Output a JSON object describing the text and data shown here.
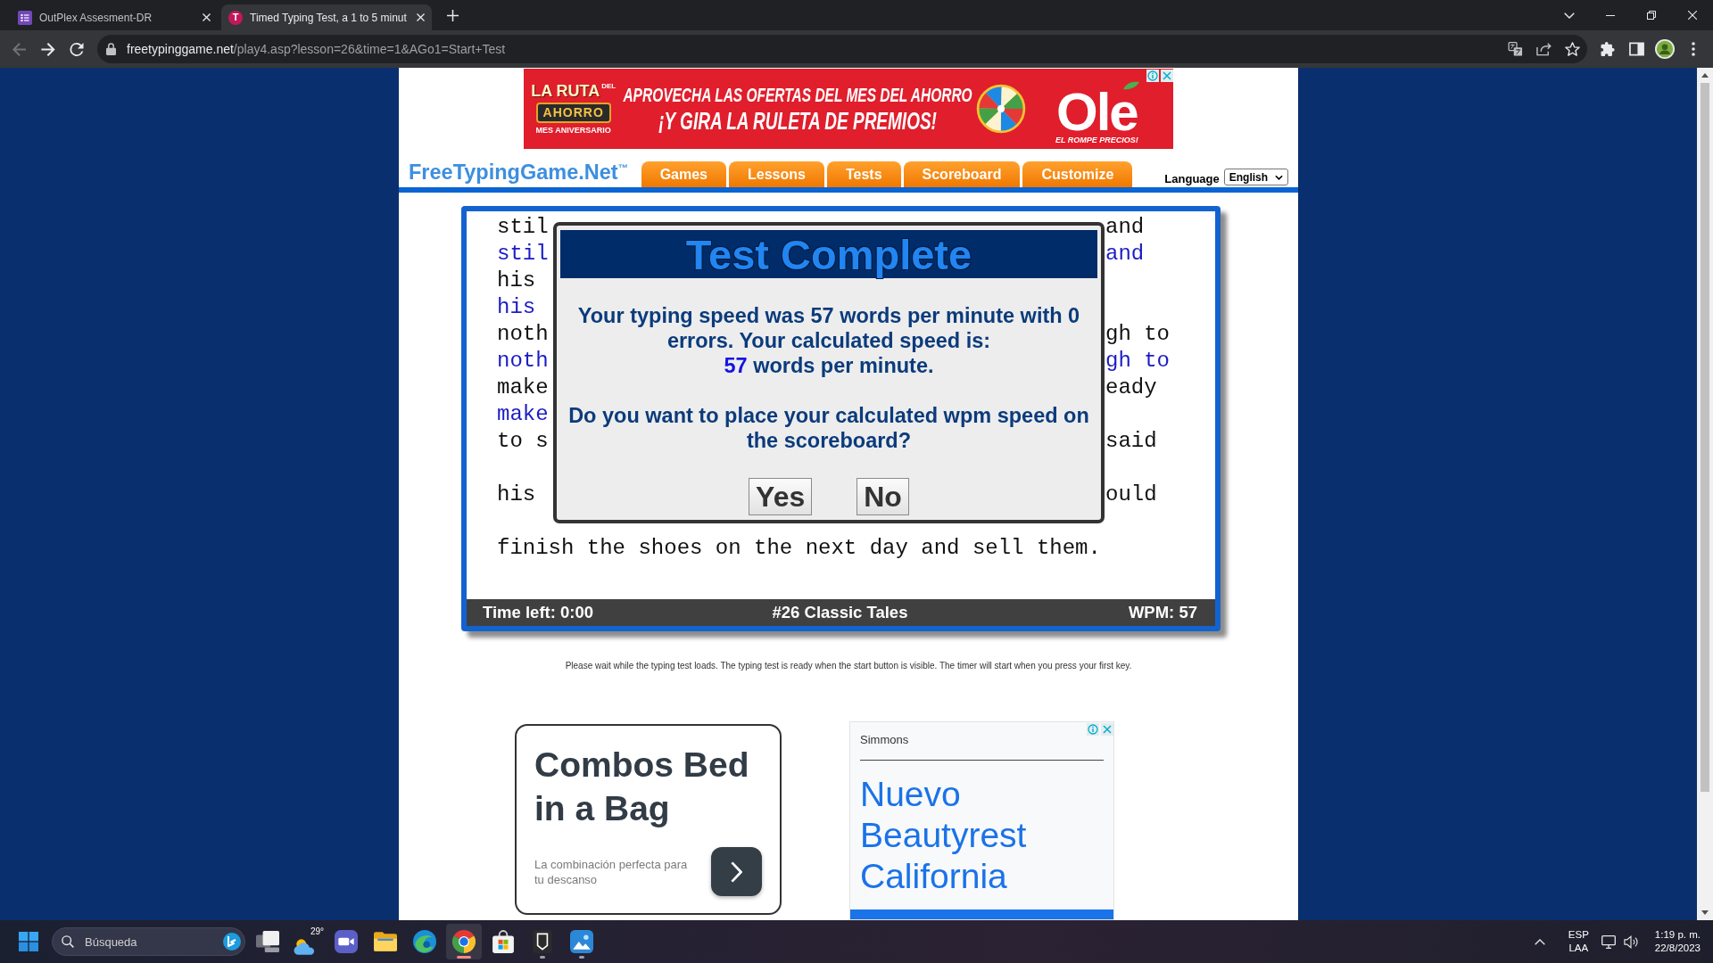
{
  "browser": {
    "tabs": [
      {
        "title": "OutPlex Assesment-DR",
        "favicon": {
          "kind": "form"
        },
        "selected": false
      },
      {
        "title": "Timed Typing Test, a 1 to 5 minut",
        "favicon": {
          "kind": "letter",
          "letter": "T"
        },
        "selected": true
      }
    ],
    "nav_buttons": [
      {
        "kind": "back",
        "disabled": true
      },
      {
        "kind": "forward",
        "disabled": false
      },
      {
        "kind": "reload",
        "disabled": false
      }
    ],
    "address": {
      "host": "freetypinggame.net",
      "path": "/play4.asp?lesson=26&time=1&AGo1=Start+Test"
    }
  },
  "top_ad": {
    "badge_title": "LA RUTA",
    "badge_small": "DEL",
    "badge_word": "AHORRO",
    "badge_caption": "MES ANIVERSARIO",
    "headline": "APROVECHA LAS OFERTAS DEL MES DEL AHORRO",
    "subheadline": "¡Y GIRA LA RULETA DE PREMIOS!",
    "brand": "Ole",
    "brand_tagline": "EL ROMPE PRECIOS!"
  },
  "site_nav": {
    "logo": "FreeTypingGame.Net$^{™}$",
    "items": [
      {
        "label": "Games",
        "selected": false
      },
      {
        "label": "Lessons",
        "selected": false
      },
      {
        "label": "Tests",
        "selected": false
      },
      {
        "label": "Scoreboard",
        "selected": false
      },
      {
        "label": "Customize",
        "selected": false
      }
    ],
    "language_label": "Language",
    "language_value": "English"
  },
  "typing_test": {
    "lines": [
      {
        "kind": "source",
        "left": "stil",
        "right": "and"
      },
      {
        "kind": "typed",
        "left": "stil",
        "right": "and"
      },
      {
        "kind": "source",
        "left": "his"
      },
      {
        "kind": "typed",
        "left": "his"
      },
      {
        "kind": "source",
        "left": "noth",
        "right": "gh to"
      },
      {
        "kind": "typed",
        "left": "noth",
        "right": "gh to"
      },
      {
        "kind": "source",
        "left": "make",
        "right": "eady"
      },
      {
        "kind": "typed",
        "left": "make"
      },
      {
        "kind": "source",
        "left": "to s",
        "right": "said"
      },
      {
        "kind": "blank"
      },
      {
        "kind": "source",
        "left": "his",
        "right": "ould"
      },
      {
        "kind": "blank"
      },
      {
        "kind": "source",
        "text": "finish the shoes on the next day and sell them."
      }
    ],
    "status": {
      "time_left": "Time left: 0:00",
      "lesson": "#26 Classic Tales",
      "wpm": "WPM: 57"
    }
  },
  "dialog": {
    "title": "Test Complete",
    "result": "Your typing speed was 57 words per minute with 0 errors. Your calculated speed is:",
    "calculated_speed": "57",
    "calculated_unit": "words per minute.",
    "question": "Do you want to place your calculated wpm speed on the scoreboard?",
    "buttons": [
      "Yes",
      "No"
    ]
  },
  "note": "Please wait while the typing test loads. The typing test is ready when the start button is visible. The timer will start when you press your first key.",
  "ads": [
    {
      "kind": "card",
      "headline": "Combos Bed in a Bag",
      "subtext": "La combinación perfecta para tu descanso"
    },
    {
      "kind": "display",
      "advertiser": "Simmons",
      "headline": "Nuevo Beautyrest California"
    }
  ],
  "taskbar": {
    "search": {
      "placeholder": "Búsqueda"
    },
    "apps": [
      {
        "kind": "taskview",
        "running": false,
        "selected": false
      },
      {
        "kind": "weather",
        "label": "29°",
        "running": false,
        "selected": false
      },
      {
        "kind": "video",
        "running": false,
        "selected": false
      },
      {
        "kind": "folder",
        "running": false,
        "selected": false
      },
      {
        "kind": "swirl",
        "running": false,
        "selected": false
      },
      {
        "kind": "browser",
        "running": true,
        "selected": true
      },
      {
        "kind": "store",
        "running": false,
        "selected": false
      },
      {
        "kind": "shield",
        "running": true,
        "selected": false
      },
      {
        "kind": "photos",
        "running": true,
        "selected": false
      }
    ],
    "input_language": "ESP",
    "keyboard_layout": "LAA",
    "time": "1:19 p. m.",
    "date": "22/8/2023"
  }
}
